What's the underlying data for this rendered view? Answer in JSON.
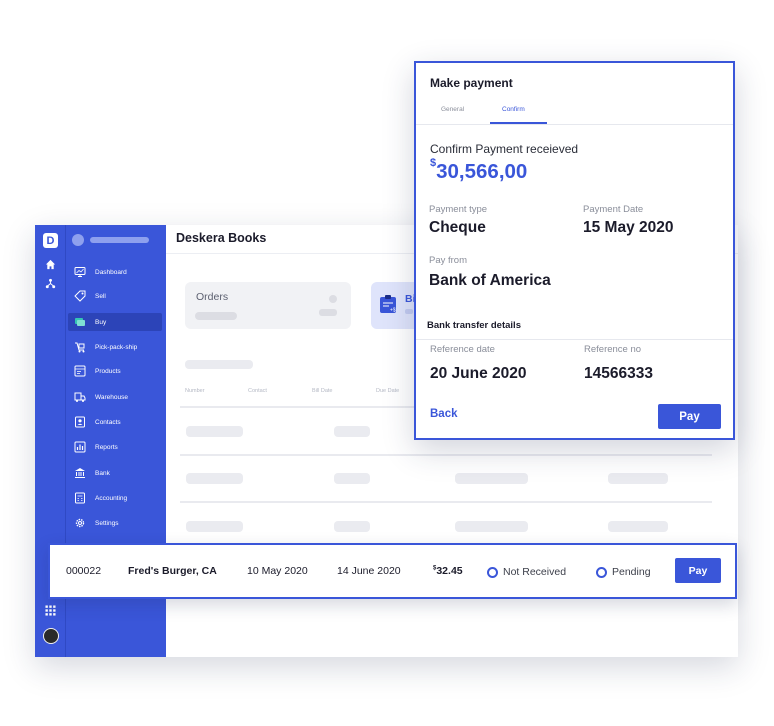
{
  "app": {
    "logo_letter": "D",
    "title": "Deskera Books",
    "nav": [
      {
        "label": "Dashboard",
        "icon": "dashboard-icon"
      },
      {
        "label": "Sell",
        "icon": "sell-tag-icon"
      },
      {
        "label": "Buy",
        "icon": "buy-cart-icon",
        "active": true
      },
      {
        "label": "Pick-pack-ship",
        "icon": "pick-pack-ship-icon"
      },
      {
        "label": "Products",
        "icon": "products-icon"
      },
      {
        "label": "Warehouse",
        "icon": "warehouse-icon"
      },
      {
        "label": "Contacts",
        "icon": "contacts-icon"
      },
      {
        "label": "Reports",
        "icon": "reports-icon"
      },
      {
        "label": "Bank",
        "icon": "bank-icon"
      },
      {
        "label": "Accounting",
        "icon": "accounting-icon"
      },
      {
        "label": "Settings",
        "icon": "settings-icon"
      }
    ],
    "cards": [
      {
        "label": "Orders"
      },
      {
        "label": "Bi"
      }
    ],
    "columns": [
      "Number",
      "Contact",
      "Bill Date",
      "Due Date"
    ]
  },
  "row": {
    "number": "000022",
    "contact": "Fred's Burger, CA",
    "bill_date": "10 May 2020",
    "due_date": "14 June 2020",
    "currency": "$",
    "amount": "32.45",
    "receive_status": "Not Received",
    "payment_status": "Pending",
    "pay_label": "Pay"
  },
  "modal": {
    "title": "Make payment",
    "tabs": [
      "General",
      "Confirm"
    ],
    "active_tab": "Confirm",
    "confirm_label": "Confirm Payment receieved",
    "currency": "$",
    "amount": "30,566,00",
    "payment_type_label": "Payment type",
    "payment_type": "Cheque",
    "payment_date_label": "Payment Date",
    "payment_date": "15 May 2020",
    "pay_from_label": "Pay from",
    "pay_from": "Bank of America",
    "bank_transfer_title": "Bank transfer details",
    "reference_date_label": "Reference date",
    "reference_date": "20 June 2020",
    "reference_no_label": "Reference no",
    "reference_no": "14566333",
    "back_label": "Back",
    "pay_label": "Pay"
  },
  "colors": {
    "accent": "#3a56d9",
    "sidebar": "#3a56d9",
    "sidebar_active": "#2c44b8"
  }
}
